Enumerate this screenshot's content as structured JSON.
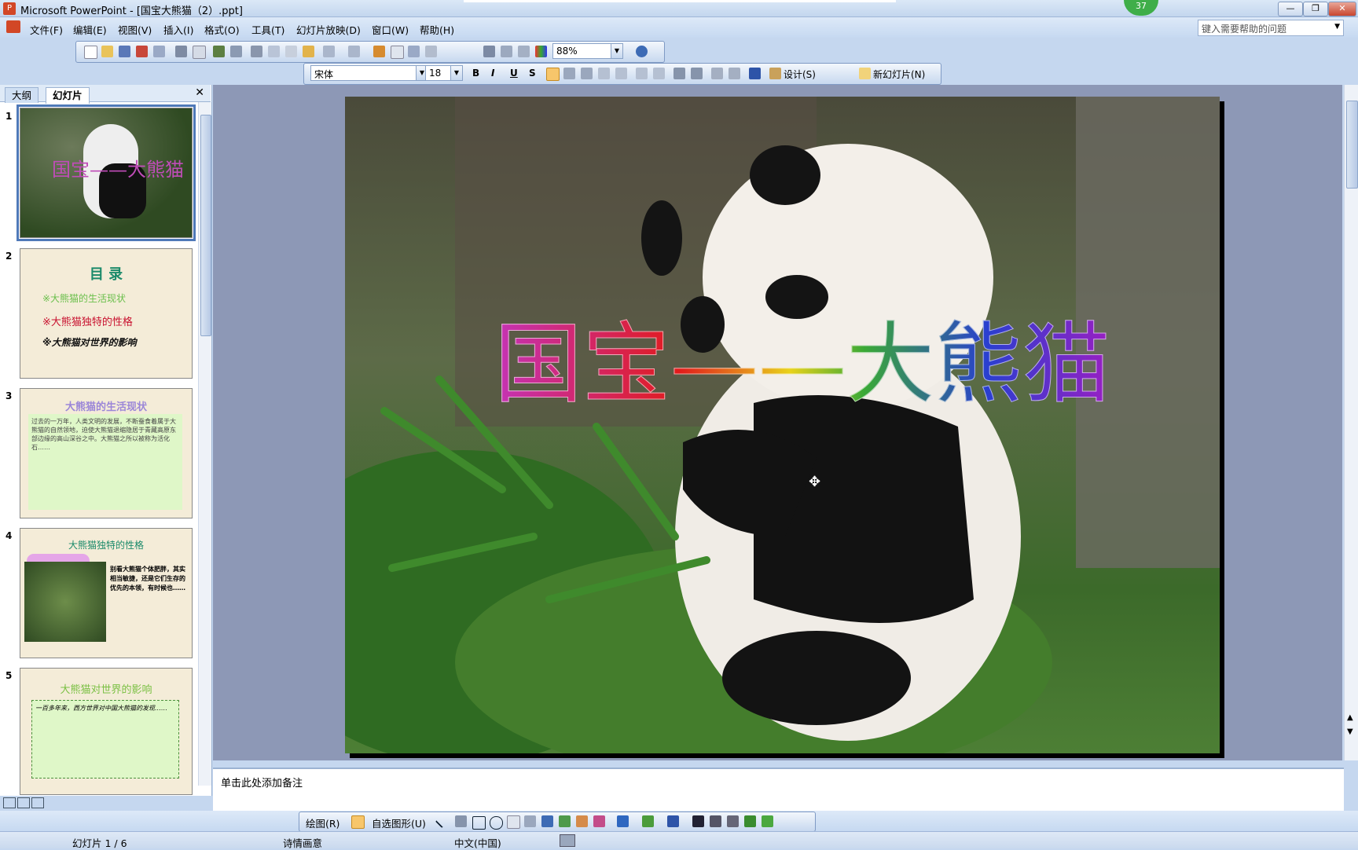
{
  "window": {
    "title": "Microsoft PowerPoint - [国宝大熊猫（2）.ppt]",
    "notification_count": "37",
    "minimize": "—",
    "restore": "❐",
    "close": "✕"
  },
  "menu": [
    "文件(F)",
    "编辑(E)",
    "视图(V)",
    "插入(I)",
    "格式(O)",
    "工具(T)",
    "幻灯片放映(D)",
    "窗口(W)",
    "帮助(H)"
  ],
  "help": {
    "placeholder": "键入需要帮助的问题"
  },
  "standard_toolbar": {
    "zoom": "88%"
  },
  "formatting_toolbar": {
    "font": "宋体",
    "size": "18",
    "bold": "B",
    "italic": "I",
    "underline": "U",
    "shadow": "S",
    "design": "设计(S)",
    "new_slide": "新幻灯片(N)"
  },
  "left_pane": {
    "tabs": [
      "大纲",
      "幻灯片"
    ],
    "thumbnails": [
      {
        "number": "1",
        "title": "国宝——大熊猫"
      },
      {
        "number": "2",
        "title": "目 录",
        "lines": [
          "※大熊猫的生活现状",
          "※大熊猫独特的性格",
          "※大熊猫对世界的影响"
        ]
      },
      {
        "number": "3",
        "title": "大熊猫的生活现状",
        "body": "过去的一万年，人类文明的发展，不断蚕食着属于大熊猫的自然领地，迫使大熊猫退缩隐居于青藏高原东部边缘的高山深谷之中。大熊猫之所以被称为活化石……"
      },
      {
        "number": "4",
        "title": "大熊猫独特的性格",
        "body": "别看大熊猫个体肥胖，其实相当敏捷，还是它们生存的优先的本领，有时候也……"
      },
      {
        "number": "5",
        "title": "大熊猫对世界的影响",
        "body": "一百多年来，西方世界对中国大熊猫的发现……"
      }
    ]
  },
  "slide": {
    "title": "国宝——大熊猫"
  },
  "notes": {
    "placeholder": "单击此处添加备注"
  },
  "drawing_toolbar": {
    "draw": "绘图(R)",
    "autoshapes": "自选图形(U)"
  },
  "status": {
    "slide_counter": "幻灯片 1 / 6",
    "design": "诗情画意",
    "language": "中文(中国)"
  }
}
